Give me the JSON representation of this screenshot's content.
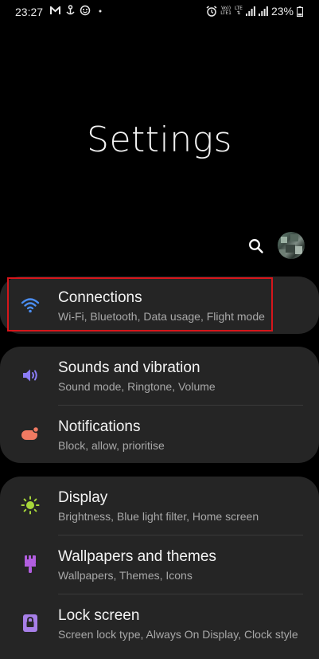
{
  "status_bar": {
    "time": "23:27",
    "left_icons": [
      "gmail-icon",
      "anchor-notification-icon",
      "smiley-notification-icon",
      "dot-icon"
    ],
    "right_icons": [
      "alarm-icon",
      "volte-icon",
      "lte-icon",
      "signal-icon",
      "signal-icon-2"
    ],
    "volte_top": "Vo))",
    "volte_bottom": "LTE1",
    "lte_label": "LTE",
    "battery_percent": "23%"
  },
  "header": {
    "title": "Settings"
  },
  "menu": {
    "group1": [
      {
        "title": "Connections",
        "subtitle": "Wi-Fi, Bluetooth, Data usage, Flight mode",
        "icon": "wifi-icon",
        "color": "#4b8df0"
      }
    ],
    "group2": [
      {
        "title": "Sounds and vibration",
        "subtitle": "Sound mode, Ringtone, Volume",
        "icon": "speaker-icon",
        "color": "#8b7cf6"
      },
      {
        "title": "Notifications",
        "subtitle": "Block, allow, prioritise",
        "icon": "notification-icon",
        "color": "#f07a62"
      }
    ],
    "group3": [
      {
        "title": "Display",
        "subtitle": "Brightness, Blue light filter, Home screen",
        "icon": "sun-icon",
        "color": "#a6d63a"
      },
      {
        "title": "Wallpapers and themes",
        "subtitle": "Wallpapers, Themes, Icons",
        "icon": "brush-icon",
        "color": "#b25ee0"
      },
      {
        "title": "Lock screen",
        "subtitle": "Screen lock type, Always On Display, Clock style",
        "icon": "lock-icon",
        "color": "#a77fe8"
      }
    ]
  },
  "colors": {
    "background": "#000000",
    "card": "#252525",
    "highlight": "#d6161b"
  }
}
